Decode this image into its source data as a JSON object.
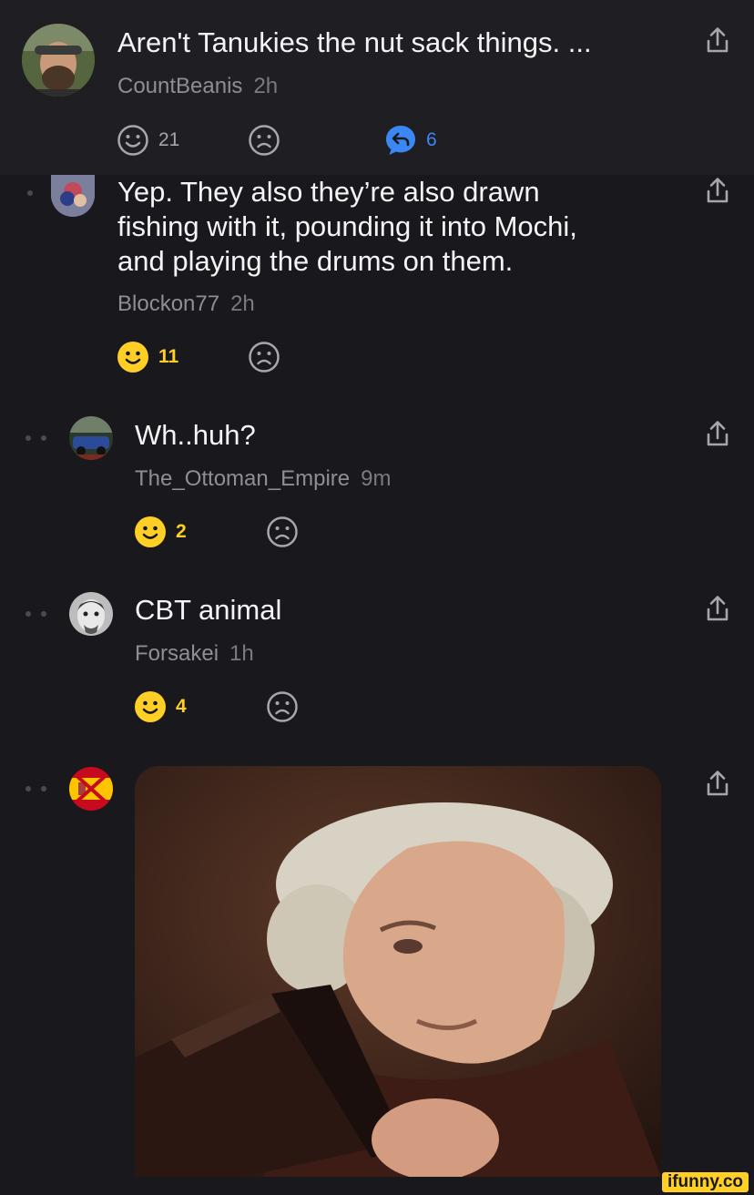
{
  "thread": {
    "parent": {
      "text": "Aren't Tanukies the nut sack things. ...",
      "author": "CountBeanis",
      "time": "2h",
      "smile_count": "21",
      "reply_count": "6"
    },
    "comments": [
      {
        "text_lines": [
          "Yep. They also they’re also drawn",
          "fishing with it, pounding it into Mochi,",
          "and playing the drums on them."
        ],
        "author": "Blockon77",
        "time": "2h",
        "smile_count": "11"
      },
      {
        "text": "Wh..huh?",
        "author": "The_Ottoman_Empire",
        "time": "9m",
        "smile_count": "2"
      },
      {
        "text": "CBT animal",
        "author": "Forsakei",
        "time": "1h",
        "smile_count": "4"
      }
    ]
  },
  "watermark": "ifunny.co",
  "colors": {
    "background": "#19181d",
    "header_background": "#1e1e23",
    "smile_active": "#ffcf26",
    "reply_blue": "#3b87f4",
    "icon_gray": "#a6a6ae"
  },
  "icons": [
    "share-icon",
    "smile-icon",
    "frown-icon",
    "reply-icon"
  ]
}
